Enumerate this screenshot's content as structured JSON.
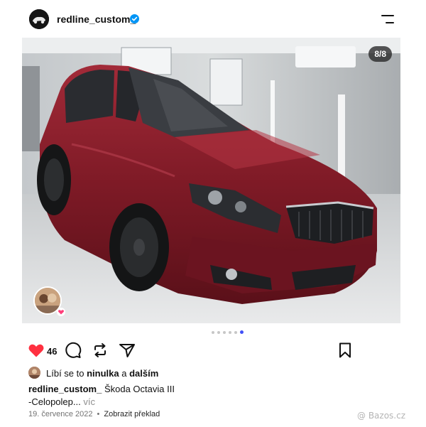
{
  "header": {
    "username": "redline_custom_",
    "verified": true,
    "avatar_icon": "profile-logo-icon",
    "menu_icon": "menu-icon"
  },
  "post": {
    "image_counter": "8/8",
    "carousel": {
      "total": 8,
      "visible_dots": 6,
      "active_dot": 6
    },
    "tagged_avatar_icon": "tagged-user-avatar"
  },
  "actions": {
    "like_icon": "heart-icon",
    "like_count": "46",
    "comment_icon": "comment-icon",
    "repost_icon": "repost-icon",
    "share_icon": "send-icon",
    "save_icon": "bookmark-icon"
  },
  "likers": {
    "prefix": "Líbí se to",
    "name": "ninulka",
    "conjunction": "a",
    "others": "dalším"
  },
  "caption": {
    "username": "redline_custom_",
    "line1": "Škoda Octavia III",
    "line2": "-Celopolep...",
    "more": "víc"
  },
  "meta": {
    "date": "19. července 2022",
    "separator": "•",
    "translate": "Zobrazit překlad"
  },
  "watermark": {
    "text": "Bazos.cz"
  },
  "colors": {
    "accent": "#4150f7",
    "like_red": "#ff3040",
    "verified_blue": "#0095f6",
    "car_red": "#8a1d2a"
  }
}
